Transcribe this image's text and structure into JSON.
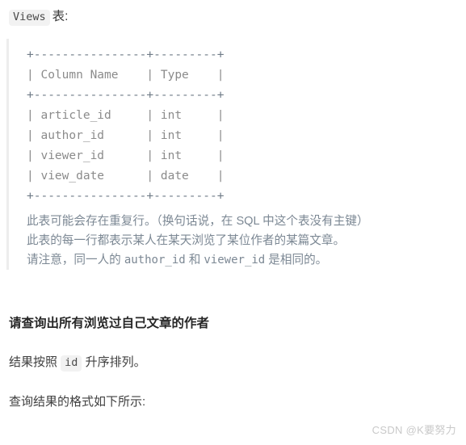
{
  "heading": {
    "code_label": "Views",
    "suffix": "表:"
  },
  "schema_table": {
    "border_line": "+----------------+---------+",
    "header_row": "| Column Name    | Type    |",
    "rows": [
      "| article_id     | int     |",
      "| author_id      | int     |",
      "| viewer_id      | int     |",
      "| view_date      | date    |"
    ],
    "columns": [
      "Column Name",
      "Type"
    ],
    "fields": [
      {
        "name": "article_id",
        "type": "int"
      },
      {
        "name": "author_id",
        "type": "int"
      },
      {
        "name": "viewer_id",
        "type": "int"
      },
      {
        "name": "view_date",
        "type": "date"
      }
    ]
  },
  "quote_notes": {
    "line1": "此表可能会存在重复行。（换句话说，在 SQL 中这个表没有主键）",
    "line2": "此表的每一行都表示某人在某天浏览了某位作者的某篇文章。",
    "line3_prefix": "请注意，同一人的 ",
    "line3_code1": "author_id",
    "line3_mid": " 和 ",
    "line3_code2": "viewer_id",
    "line3_suffix": " 是相同的。"
  },
  "body": {
    "task": "请查询出所有浏览过自己文章的作者",
    "order_prefix": "结果按照 ",
    "order_code": "id",
    "order_suffix": " 升序排列。",
    "format_note": "查询结果的格式如下所示:"
  },
  "watermark": {
    "text": "CSDN @K要努力"
  }
}
